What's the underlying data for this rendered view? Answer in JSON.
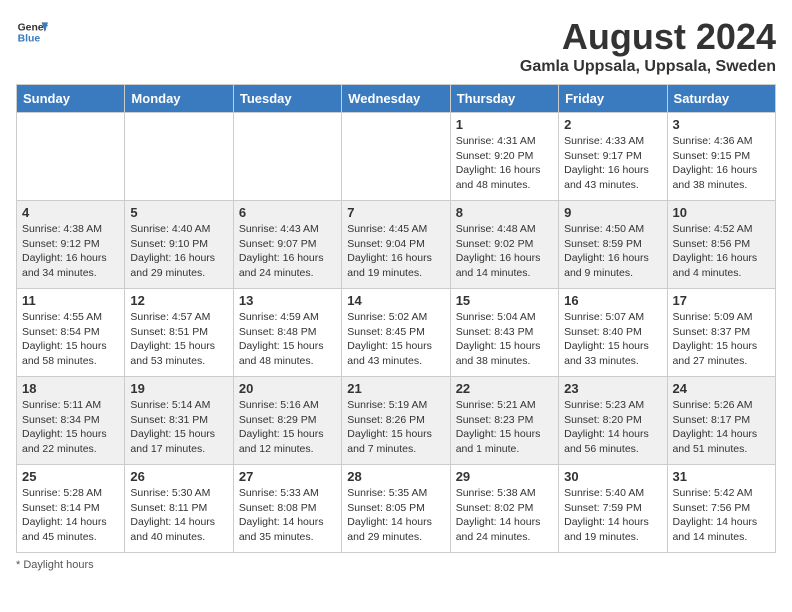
{
  "header": {
    "logo_general": "General",
    "logo_blue": "Blue",
    "title": "August 2024",
    "subtitle": "Gamla Uppsala, Uppsala, Sweden"
  },
  "columns": [
    "Sunday",
    "Monday",
    "Tuesday",
    "Wednesday",
    "Thursday",
    "Friday",
    "Saturday"
  ],
  "weeks": [
    [
      {
        "day": "",
        "info": ""
      },
      {
        "day": "",
        "info": ""
      },
      {
        "day": "",
        "info": ""
      },
      {
        "day": "",
        "info": ""
      },
      {
        "day": "1",
        "info": "Sunrise: 4:31 AM\nSunset: 9:20 PM\nDaylight: 16 hours\nand 48 minutes."
      },
      {
        "day": "2",
        "info": "Sunrise: 4:33 AM\nSunset: 9:17 PM\nDaylight: 16 hours\nand 43 minutes."
      },
      {
        "day": "3",
        "info": "Sunrise: 4:36 AM\nSunset: 9:15 PM\nDaylight: 16 hours\nand 38 minutes."
      }
    ],
    [
      {
        "day": "4",
        "info": "Sunrise: 4:38 AM\nSunset: 9:12 PM\nDaylight: 16 hours\nand 34 minutes."
      },
      {
        "day": "5",
        "info": "Sunrise: 4:40 AM\nSunset: 9:10 PM\nDaylight: 16 hours\nand 29 minutes."
      },
      {
        "day": "6",
        "info": "Sunrise: 4:43 AM\nSunset: 9:07 PM\nDaylight: 16 hours\nand 24 minutes."
      },
      {
        "day": "7",
        "info": "Sunrise: 4:45 AM\nSunset: 9:04 PM\nDaylight: 16 hours\nand 19 minutes."
      },
      {
        "day": "8",
        "info": "Sunrise: 4:48 AM\nSunset: 9:02 PM\nDaylight: 16 hours\nand 14 minutes."
      },
      {
        "day": "9",
        "info": "Sunrise: 4:50 AM\nSunset: 8:59 PM\nDaylight: 16 hours\nand 9 minutes."
      },
      {
        "day": "10",
        "info": "Sunrise: 4:52 AM\nSunset: 8:56 PM\nDaylight: 16 hours\nand 4 minutes."
      }
    ],
    [
      {
        "day": "11",
        "info": "Sunrise: 4:55 AM\nSunset: 8:54 PM\nDaylight: 15 hours\nand 58 minutes."
      },
      {
        "day": "12",
        "info": "Sunrise: 4:57 AM\nSunset: 8:51 PM\nDaylight: 15 hours\nand 53 minutes."
      },
      {
        "day": "13",
        "info": "Sunrise: 4:59 AM\nSunset: 8:48 PM\nDaylight: 15 hours\nand 48 minutes."
      },
      {
        "day": "14",
        "info": "Sunrise: 5:02 AM\nSunset: 8:45 PM\nDaylight: 15 hours\nand 43 minutes."
      },
      {
        "day": "15",
        "info": "Sunrise: 5:04 AM\nSunset: 8:43 PM\nDaylight: 15 hours\nand 38 minutes."
      },
      {
        "day": "16",
        "info": "Sunrise: 5:07 AM\nSunset: 8:40 PM\nDaylight: 15 hours\nand 33 minutes."
      },
      {
        "day": "17",
        "info": "Sunrise: 5:09 AM\nSunset: 8:37 PM\nDaylight: 15 hours\nand 27 minutes."
      }
    ],
    [
      {
        "day": "18",
        "info": "Sunrise: 5:11 AM\nSunset: 8:34 PM\nDaylight: 15 hours\nand 22 minutes."
      },
      {
        "day": "19",
        "info": "Sunrise: 5:14 AM\nSunset: 8:31 PM\nDaylight: 15 hours\nand 17 minutes."
      },
      {
        "day": "20",
        "info": "Sunrise: 5:16 AM\nSunset: 8:29 PM\nDaylight: 15 hours\nand 12 minutes."
      },
      {
        "day": "21",
        "info": "Sunrise: 5:19 AM\nSunset: 8:26 PM\nDaylight: 15 hours\nand 7 minutes."
      },
      {
        "day": "22",
        "info": "Sunrise: 5:21 AM\nSunset: 8:23 PM\nDaylight: 15 hours\nand 1 minute."
      },
      {
        "day": "23",
        "info": "Sunrise: 5:23 AM\nSunset: 8:20 PM\nDaylight: 14 hours\nand 56 minutes."
      },
      {
        "day": "24",
        "info": "Sunrise: 5:26 AM\nSunset: 8:17 PM\nDaylight: 14 hours\nand 51 minutes."
      }
    ],
    [
      {
        "day": "25",
        "info": "Sunrise: 5:28 AM\nSunset: 8:14 PM\nDaylight: 14 hours\nand 45 minutes."
      },
      {
        "day": "26",
        "info": "Sunrise: 5:30 AM\nSunset: 8:11 PM\nDaylight: 14 hours\nand 40 minutes."
      },
      {
        "day": "27",
        "info": "Sunrise: 5:33 AM\nSunset: 8:08 PM\nDaylight: 14 hours\nand 35 minutes."
      },
      {
        "day": "28",
        "info": "Sunrise: 5:35 AM\nSunset: 8:05 PM\nDaylight: 14 hours\nand 29 minutes."
      },
      {
        "day": "29",
        "info": "Sunrise: 5:38 AM\nSunset: 8:02 PM\nDaylight: 14 hours\nand 24 minutes."
      },
      {
        "day": "30",
        "info": "Sunrise: 5:40 AM\nSunset: 7:59 PM\nDaylight: 14 hours\nand 19 minutes."
      },
      {
        "day": "31",
        "info": "Sunrise: 5:42 AM\nSunset: 7:56 PM\nDaylight: 14 hours\nand 14 minutes."
      }
    ]
  ],
  "footer": {
    "note": "Daylight hours"
  }
}
